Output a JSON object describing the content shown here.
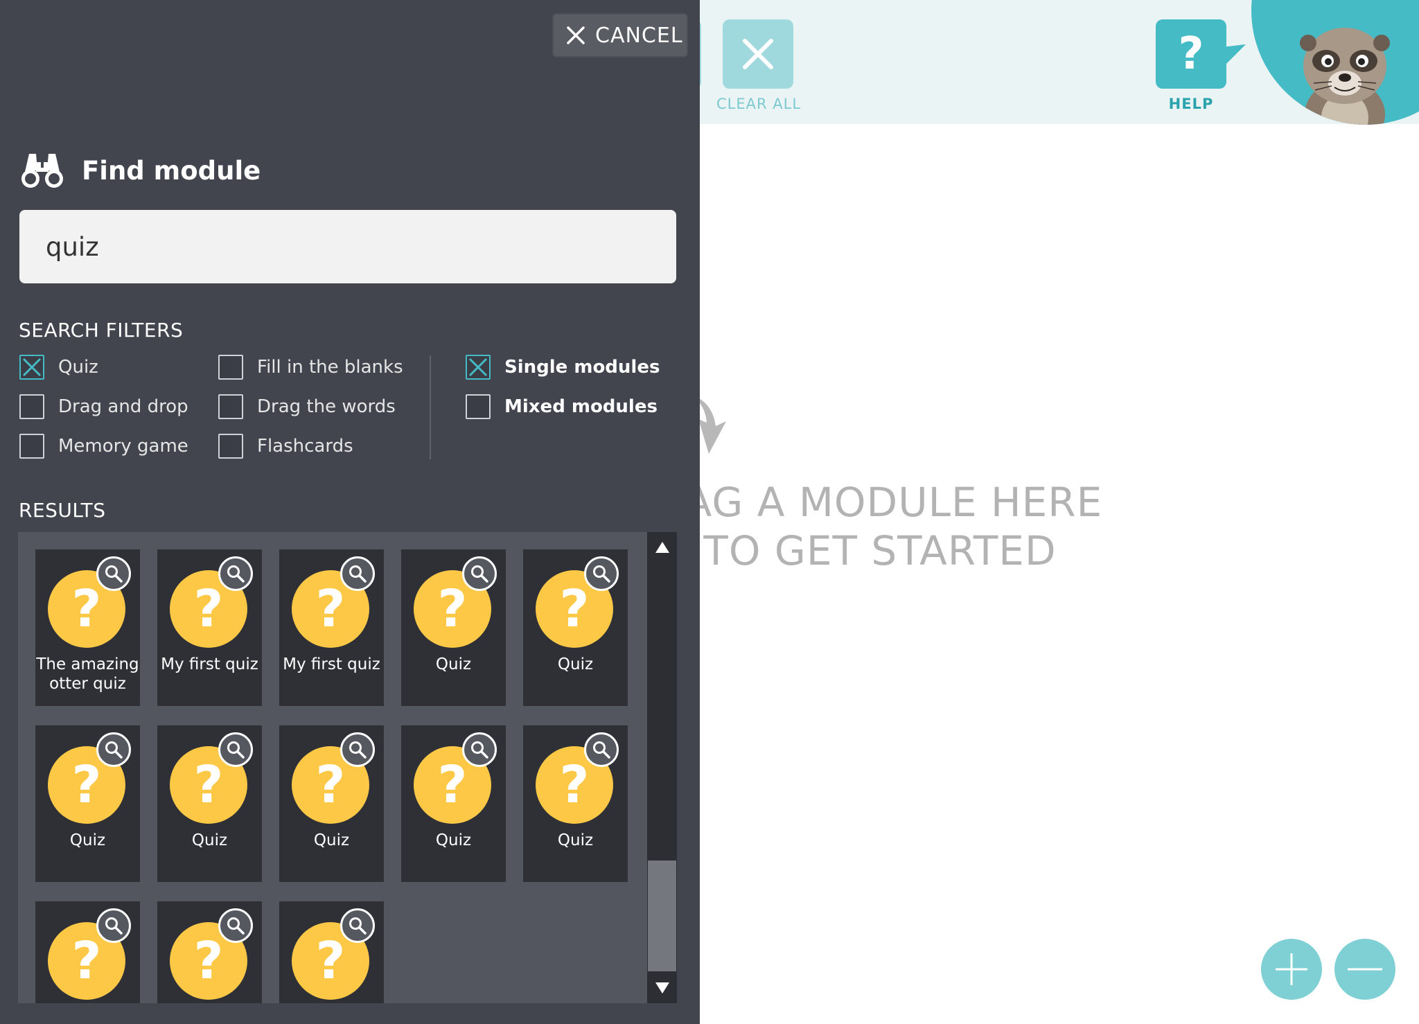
{
  "toolbar": {
    "clear_all_label": "CLEAR ALL",
    "help_label": "HELP",
    "help_glyph": "?"
  },
  "canvas": {
    "drop_hint_line1": "RAG A MODULE HERE",
    "drop_hint_line2": "TO GET STARTED"
  },
  "panel": {
    "cancel_label": "CANCEL",
    "title": "Find module",
    "search_value": "quiz",
    "filters_heading": "SEARCH FILTERS",
    "results_heading": "RESULTS",
    "filters": [
      {
        "label": "Quiz",
        "checked": true
      },
      {
        "label": "Drag and drop",
        "checked": false
      },
      {
        "label": "Memory game",
        "checked": false
      },
      {
        "label": "Fill in the blanks",
        "checked": false
      },
      {
        "label": "Drag the words",
        "checked": false
      },
      {
        "label": "Flashcards",
        "checked": false
      },
      {
        "label": "Single modules",
        "checked": true
      },
      {
        "label": "Mixed modules",
        "checked": false
      }
    ],
    "results": [
      {
        "name": "The amazing otter quiz"
      },
      {
        "name": "My first quiz"
      },
      {
        "name": "My first quiz"
      },
      {
        "name": "Quiz"
      },
      {
        "name": "Quiz"
      },
      {
        "name": "Quiz"
      },
      {
        "name": "Quiz"
      },
      {
        "name": "Quiz"
      },
      {
        "name": "Quiz"
      },
      {
        "name": "Quiz"
      },
      {
        "name": ""
      },
      {
        "name": ""
      },
      {
        "name": ""
      }
    ],
    "result_glyph": "?"
  },
  "colors": {
    "panel_bg": "#42454e",
    "accent_teal": "#45bcc5",
    "tile_yellow": "#fcc846"
  }
}
